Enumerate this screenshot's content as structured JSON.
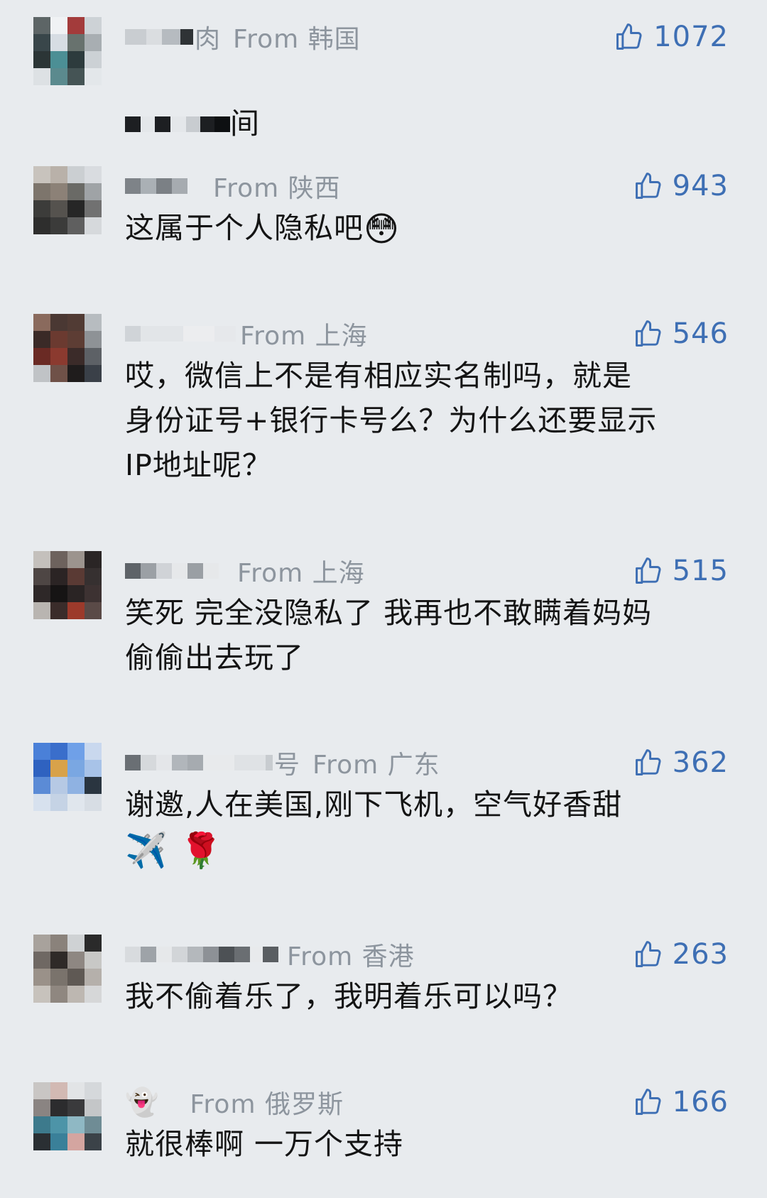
{
  "comments": [
    {
      "username_fragment": "肉",
      "location": "From 韩国",
      "likes": "1072",
      "text_fragment": "间",
      "text": ""
    },
    {
      "location": "From 陕西",
      "likes": "943",
      "text": "这属于个人隐私吧",
      "emoji": "😳"
    },
    {
      "location": "From 上海",
      "likes": "546",
      "text": "哎，微信上不是有相应实名制吗，就是\n身份证号+银行卡号么？为什么还要显示\nIP地址呢？"
    },
    {
      "location": "From 上海",
      "likes": "515",
      "text": "笑死 完全没隐私了 我再也不敢瞒着妈妈\n偷偷出去玩了"
    },
    {
      "username_fragment": "号",
      "location": "From 广东",
      "likes": "362",
      "text": "谢邀,人在美国,刚下飞机，空气好香甜",
      "emoji": "✈️ 🌹"
    },
    {
      "location": "From 香港",
      "likes": "263",
      "text": "我不偷着乐了，我明着乐可以吗？"
    },
    {
      "username_emoji": "👻",
      "location": "From 俄罗斯",
      "likes": "166",
      "text": "就很棒啊 一万个支持"
    }
  ],
  "colors": {
    "background": "#e8ebee",
    "meta_gray": "#8d959e",
    "like_blue": "#3e6fb4",
    "text": "#141414"
  },
  "icons": {
    "like": "thumbs-up-icon"
  }
}
